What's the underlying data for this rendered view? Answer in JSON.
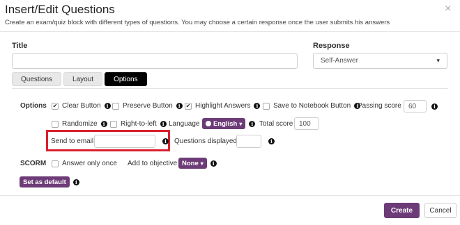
{
  "dialog": {
    "title": "Insert/Edit Questions",
    "subtitle": "Create an exam/quiz block with different types of questions. You may choose a certain response once the user submits his answers",
    "close_glyph": "×"
  },
  "form": {
    "title_label": "Title",
    "title_value": "",
    "response_label": "Response",
    "response_value": "Self-Answer",
    "response_caret": "▾"
  },
  "tabs": [
    {
      "label": "Questions",
      "active": false
    },
    {
      "label": "Layout",
      "active": false
    },
    {
      "label": "Options",
      "active": true
    }
  ],
  "options": {
    "section_label": "Options",
    "clear_button": {
      "label": "Clear Button",
      "checked": true
    },
    "preserve_button": {
      "label": "Preserve Button",
      "checked": false
    },
    "highlight_answers": {
      "label": "Highlight Answers",
      "checked": true
    },
    "save_to_notebook": {
      "label": "Save to Notebook Button",
      "checked": false
    },
    "passing_score": {
      "label": "Passing score",
      "value": "60"
    },
    "randomize": {
      "label": "Randomize",
      "checked": false
    },
    "right_to_left": {
      "label": "Right-to-left",
      "checked": false
    },
    "language": {
      "label": "Language",
      "value": "English",
      "icon": "globe-icon",
      "caret": "▾"
    },
    "total_score": {
      "label": "Total score",
      "value": "100"
    },
    "send_to_email": {
      "label": "Send to email",
      "value": ""
    },
    "questions_displayed": {
      "label": "Questions displayed",
      "value": ""
    }
  },
  "scorm": {
    "section_label": "SCORM",
    "answer_only_once": {
      "label": "Answer only once",
      "checked": false
    },
    "add_to_objective": {
      "label": "Add to objective",
      "value": "None",
      "caret": "▾"
    }
  },
  "set_as_default_label": "Set as default",
  "footer": {
    "create_label": "Create",
    "cancel_label": "Cancel"
  },
  "colors": {
    "accent_purple": "#6d3c78",
    "highlight_red": "#d9202e",
    "active_tab_bg": "#000000"
  },
  "info_glyph": "i",
  "check_glyph": "✔"
}
